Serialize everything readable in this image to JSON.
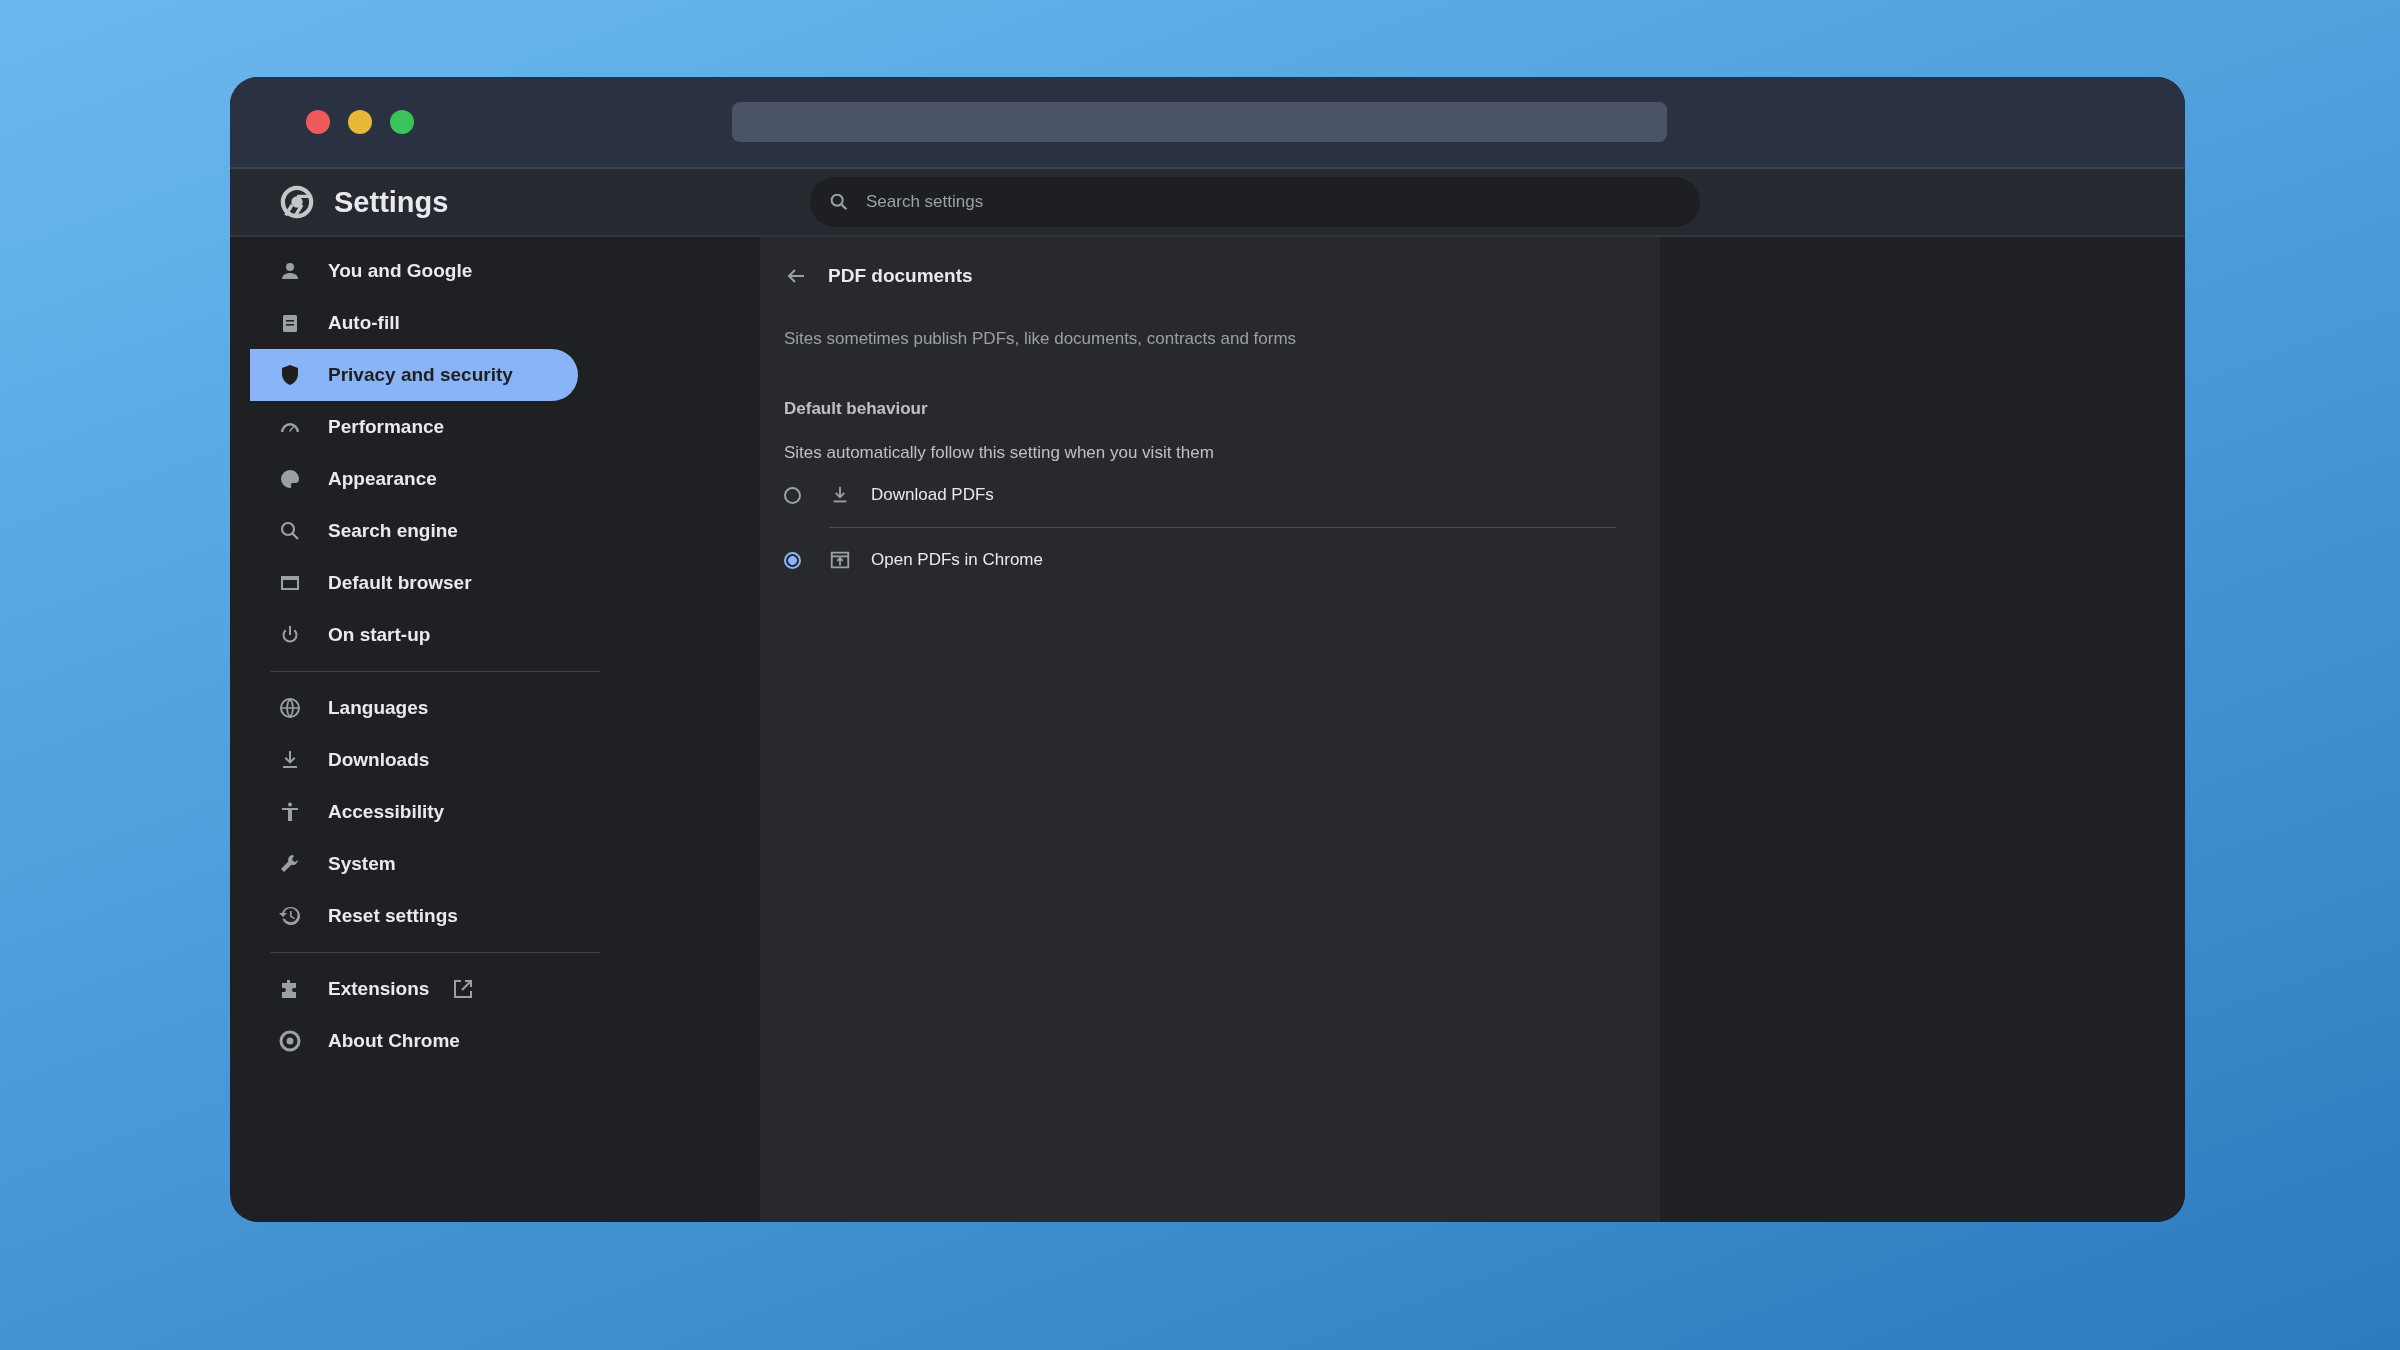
{
  "header": {
    "title": "Settings",
    "search": {
      "placeholder": "Search settings"
    }
  },
  "sidebar": {
    "groups": [
      {
        "items": [
          {
            "label": "You and Google",
            "selected": false,
            "external": false
          },
          {
            "label": "Auto-fill",
            "selected": false,
            "external": false
          },
          {
            "label": "Privacy and security",
            "selected": true,
            "external": false
          },
          {
            "label": "Performance",
            "selected": false,
            "external": false
          },
          {
            "label": "Appearance",
            "selected": false,
            "external": false
          },
          {
            "label": "Search engine",
            "selected": false,
            "external": false
          },
          {
            "label": "Default browser",
            "selected": false,
            "external": false
          },
          {
            "label": "On start-up",
            "selected": false,
            "external": false
          }
        ]
      },
      {
        "items": [
          {
            "label": "Languages",
            "selected": false,
            "external": false
          },
          {
            "label": "Downloads",
            "selected": false,
            "external": false
          },
          {
            "label": "Accessibility",
            "selected": false,
            "external": false
          },
          {
            "label": "System",
            "selected": false,
            "external": false
          },
          {
            "label": "Reset settings",
            "selected": false,
            "external": false
          }
        ]
      },
      {
        "items": [
          {
            "label": "Extensions",
            "selected": false,
            "external": true
          },
          {
            "label": "About Chrome",
            "selected": false,
            "external": false
          }
        ]
      }
    ]
  },
  "page": {
    "title": "PDF documents",
    "description": "Sites sometimes publish PDFs, like documents, contracts and forms",
    "section": "Default behaviour",
    "hint": "Sites automatically follow this setting when you visit them",
    "options": [
      {
        "label": "Download PDFs",
        "selected": false
      },
      {
        "label": "Open PDFs in Chrome",
        "selected": true
      }
    ]
  }
}
